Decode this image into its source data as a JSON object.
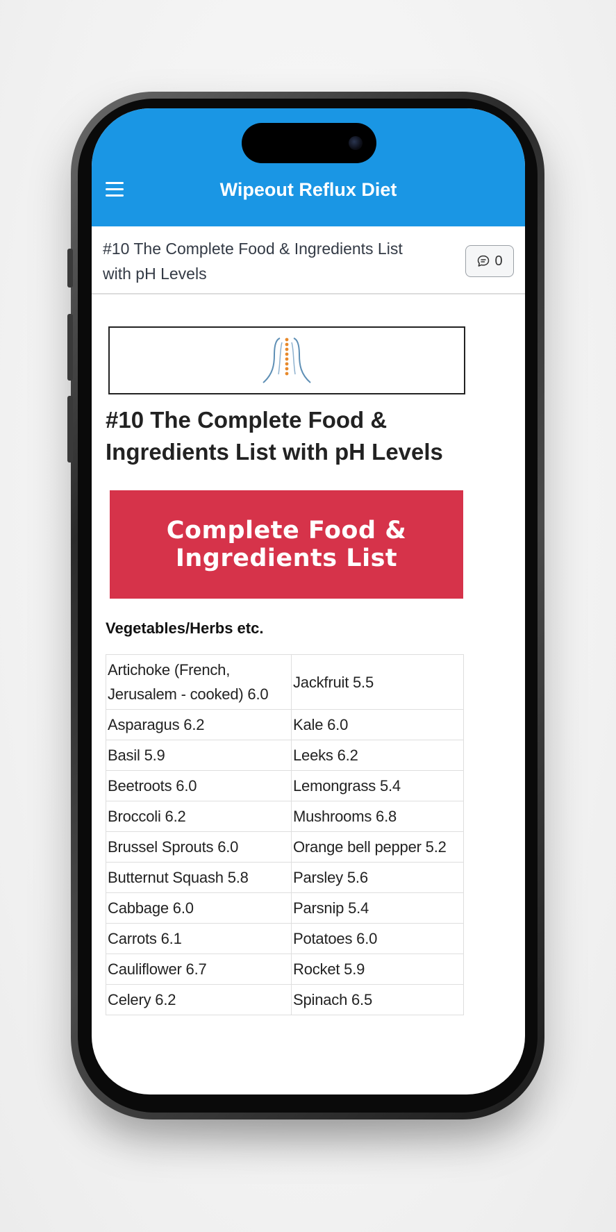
{
  "app": {
    "title": "Wipeout Reflux Diet"
  },
  "subheader": {
    "title": "#10 The Complete Food & Ingredients List with pH Levels",
    "comment_count": "0"
  },
  "article": {
    "title": "#10 The Complete Food & Ingredients List with pH Levels",
    "banner_line1": "Complete Food &",
    "banner_line2": "Ingredients List",
    "section_heading": "Vegetables/Herbs etc."
  },
  "table": {
    "rows": [
      [
        "Artichoke (French, Jerusalem - cooked) 6.0",
        "Jackfruit 5.5"
      ],
      [
        "Asparagus 6.2",
        "Kale 6.0"
      ],
      [
        "Basil 5.9",
        "Leeks 6.2"
      ],
      [
        "Beetroots 6.0",
        "Lemongrass 5.4"
      ],
      [
        "Broccoli 6.2",
        "Mushrooms 6.8"
      ],
      [
        "Brussel Sprouts 6.0",
        "Orange bell pepper 5.2"
      ],
      [
        "Butternut Squash 5.8",
        "Parsley 5.6"
      ],
      [
        "Cabbage 6.0",
        "Parsnip 5.4"
      ],
      [
        "Carrots 6.1",
        "Potatoes 6.0"
      ],
      [
        "Cauliflower 6.7",
        "Rocket 5.9"
      ],
      [
        "Celery 6.2",
        "Spinach 6.5"
      ]
    ]
  },
  "colors": {
    "appbar": "#1a96e4",
    "banner": "#d6334a"
  },
  "icons": {
    "menu": "hamburger-menu-icon",
    "comment": "comment-bubble-icon",
    "logo": "spine-logo-icon"
  }
}
